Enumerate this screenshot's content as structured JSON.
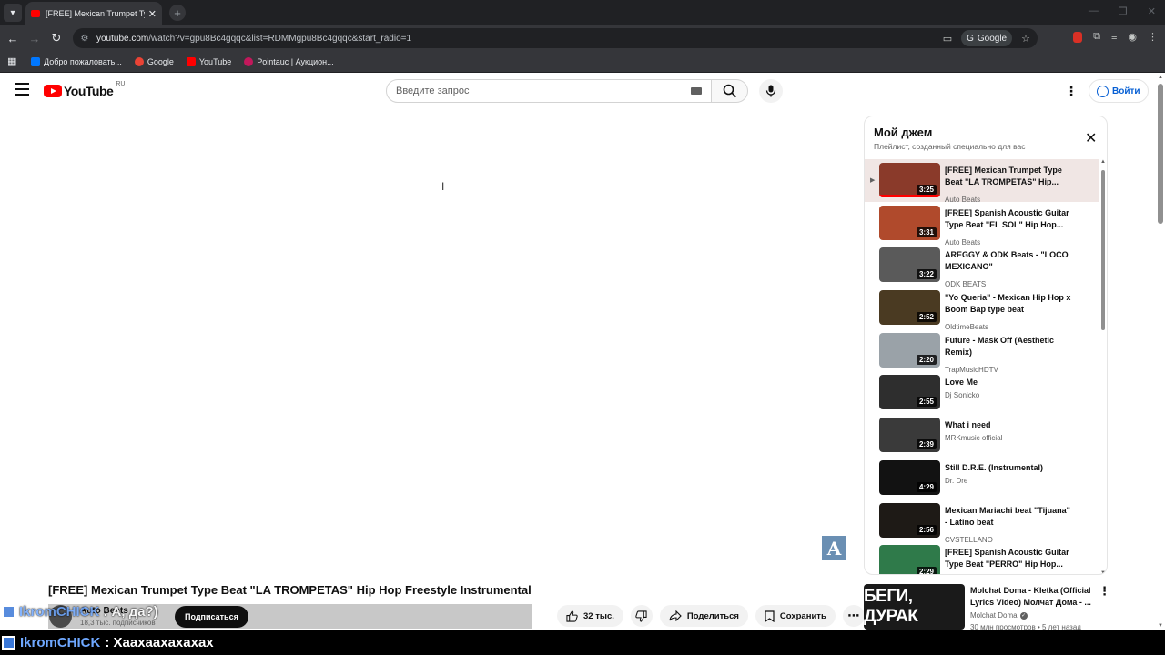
{
  "browser": {
    "tab_title": "[FREE] Mexican Trumpet Type B",
    "url_host": "youtube.com",
    "url_path": "/watch?v=gpu8Bc4gqqc&list=RDMMgpu8Bc4gqqc&start_radio=1",
    "google_chip": "Google",
    "bookmarks": [
      {
        "label": "Добро пожаловать...",
        "color": "#0077ff"
      },
      {
        "label": "Google",
        "color": "#ea4335"
      },
      {
        "label": "YouTube",
        "color": "#ff0000"
      },
      {
        "label": "Pointauc | Аукцион...",
        "color": "#c2185b"
      }
    ]
  },
  "header": {
    "logo_text": "YouTube",
    "region": "RU",
    "search_placeholder": "Введите запрос",
    "signin_label": "Войти"
  },
  "video": {
    "title": "[FREE] Mexican Trumpet Type Beat \"LA TROMPETAS\" Hip Hop Freestyle Instrumental",
    "channel": "Auto Beats",
    "subscribers": "18,3 тыс. подписчиков",
    "subscribe_label": "Подписаться",
    "likes": "32 тыс.",
    "share_label": "Поделиться",
    "save_label": "Сохранить"
  },
  "chat": {
    "line1_name": "IkromCHICK",
    "line1_text": ": А, да?)",
    "line2_name": "IkromCHICK",
    "line2_text": ": Хаахаахахахах"
  },
  "playlist": {
    "title": "Мой джем",
    "subtitle": "Плейлист, созданный специально для вас",
    "items": [
      {
        "title": "[FREE] Mexican Trumpet Type Beat \"LA TROMPETAS\" Hip...",
        "channel": "Auto Beats",
        "duration": "3:25",
        "thumb": "#8a3a2a"
      },
      {
        "title": "[FREE] Spanish Acoustic Guitar Type Beat \"EL SOL\" Hip Hop...",
        "channel": "Auto Beats",
        "duration": "3:31",
        "thumb": "#b04a2c"
      },
      {
        "title": "AREGGY & ODK Beats - \"LOCO MEXICANO\"",
        "channel": "ODK BEATS",
        "duration": "3:22",
        "thumb": "#5a5a5a"
      },
      {
        "title": "\"Yo Queria\" - Mexican Hip Hop x Boom Bap type beat",
        "channel": "OldtimeBeats",
        "duration": "2:52",
        "thumb": "#4a3a22"
      },
      {
        "title": "Future - Mask Off (Aesthetic Remix)",
        "channel": "TrapMusicHDTV",
        "duration": "2:20",
        "thumb": "#9aa2a8"
      },
      {
        "title": "Love Me",
        "channel": "Dj Sonicko",
        "duration": "2:55",
        "thumb": "#2e2e2e"
      },
      {
        "title": "What i need",
        "channel": "MRKmusic official",
        "duration": "2:39",
        "thumb": "#3a3a3a"
      },
      {
        "title": "Still D.R.E. (Instrumental)",
        "channel": "Dr. Dre",
        "duration": "4:29",
        "thumb": "#121212"
      },
      {
        "title": "Mexican Mariachi beat \"Tijuana\" - Latino beat",
        "channel": "CVSTELLANO",
        "duration": "2:56",
        "thumb": "#1e1a16"
      },
      {
        "title": "[FREE] Spanish Acoustic Guitar Type Beat \"PERRO\" Hip Hop...",
        "channel": "Auto Beats",
        "duration": "2:29",
        "thumb": "#2f7a4a"
      }
    ]
  },
  "recommended": {
    "thumb_text": "БЕГИ, ДУРАК",
    "title": "Molchat Doma - Kletka (Official Lyrics Video) Молчат Дома - ...",
    "channel": "Molchat Doma",
    "meta": "30 млн просмотров • 5 лет назад"
  },
  "icons": {
    "menu": "hamburger-icon",
    "search": "search-icon",
    "mic": "microphone-icon",
    "like": "thumbs-up-icon",
    "dislike": "thumbs-down-icon",
    "share": "share-icon",
    "save": "bookmark-icon"
  }
}
